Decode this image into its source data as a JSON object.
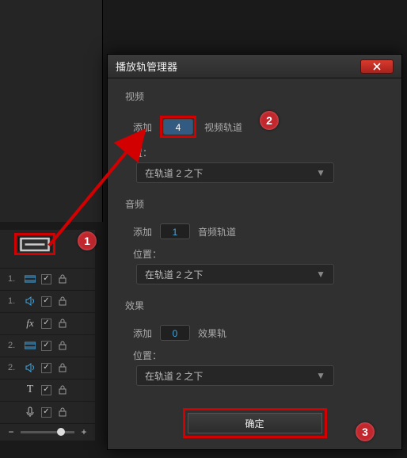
{
  "dialog": {
    "title": "播放轨管理器",
    "video": {
      "section_label": "视频",
      "add_label": "添加",
      "count": "4",
      "suffix": "视频轨道",
      "pos_label": "置：",
      "dropdown": "在轨道 2 之下"
    },
    "audio": {
      "section_label": "音频",
      "add_label": "添加",
      "count": "1",
      "suffix": "音频轨道",
      "pos_label": "位置：",
      "dropdown": "在轨道 2 之下"
    },
    "effect": {
      "section_label": "效果",
      "add_label": "添加",
      "count": "0",
      "suffix": "效果轨",
      "pos_label": "位置：",
      "dropdown": "在轨道 2 之下"
    },
    "ok_label": "确定"
  },
  "tracks": {
    "r1": "1.",
    "r2": "1.",
    "r3": "",
    "r4": "2.",
    "r5": "2.",
    "r6": "T",
    "r7": ""
  },
  "markers": {
    "m1": "1",
    "m2": "2",
    "m3": "3"
  },
  "fx": "fx"
}
